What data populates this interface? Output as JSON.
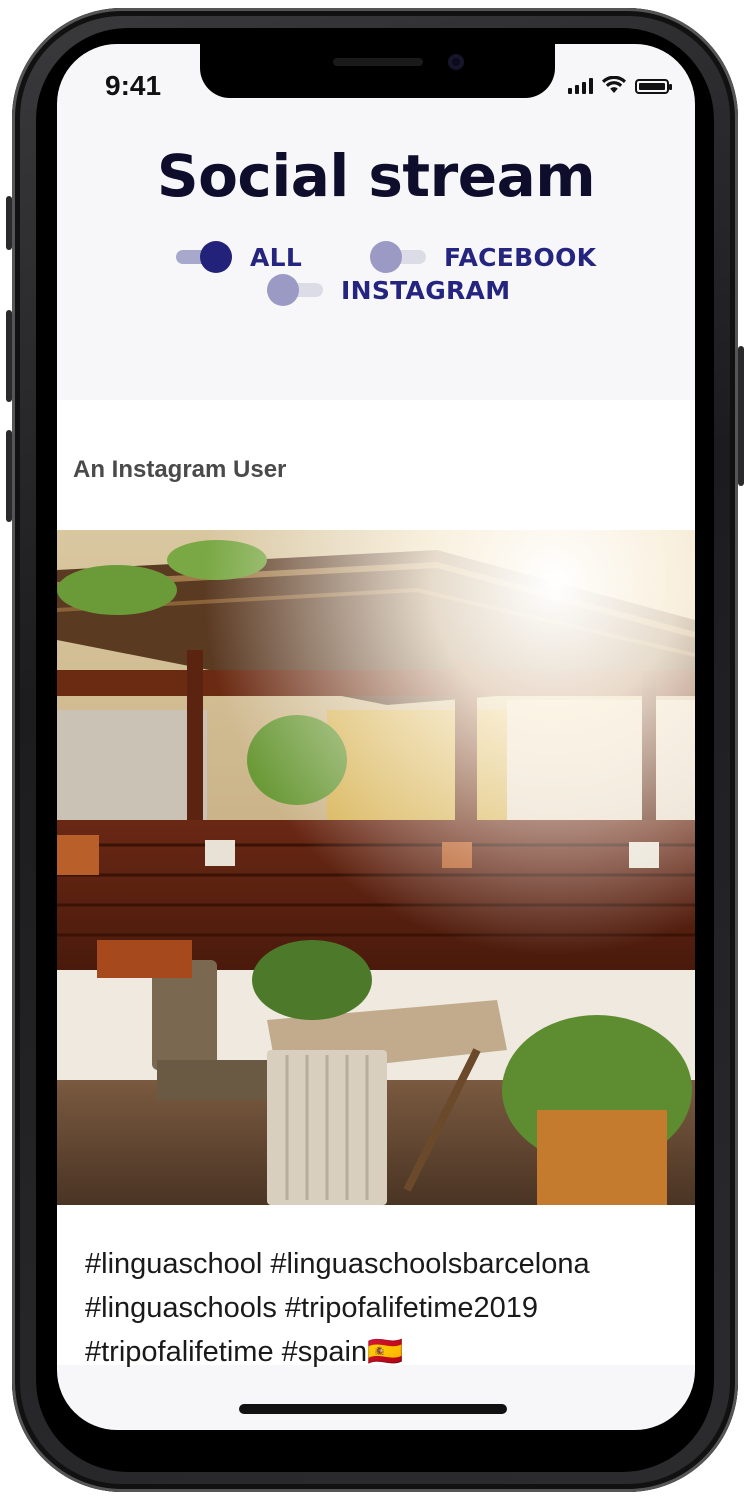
{
  "status_bar": {
    "time": "9:41",
    "icons": [
      "signal-icon",
      "wifi-icon",
      "battery-icon"
    ]
  },
  "header": {
    "title": "Social stream"
  },
  "filters": [
    {
      "label": "ALL",
      "active": true
    },
    {
      "label": "FACEBOOK",
      "active": false
    },
    {
      "label": "INSTAGRAM",
      "active": false
    }
  ],
  "post": {
    "author": "An Instagram User",
    "image": "terrace-photo",
    "caption": [
      "#linguaschool #linguaschoolsbarcelona",
      "#linguaschools #tripofalifetime2019",
      "#tripofalifetime #spain🇪🇸"
    ]
  },
  "colors": {
    "accent": "#22227a",
    "toggle_off": "#9a9ac4",
    "title": "#0e0e2c",
    "background": "#f7f7fa"
  }
}
